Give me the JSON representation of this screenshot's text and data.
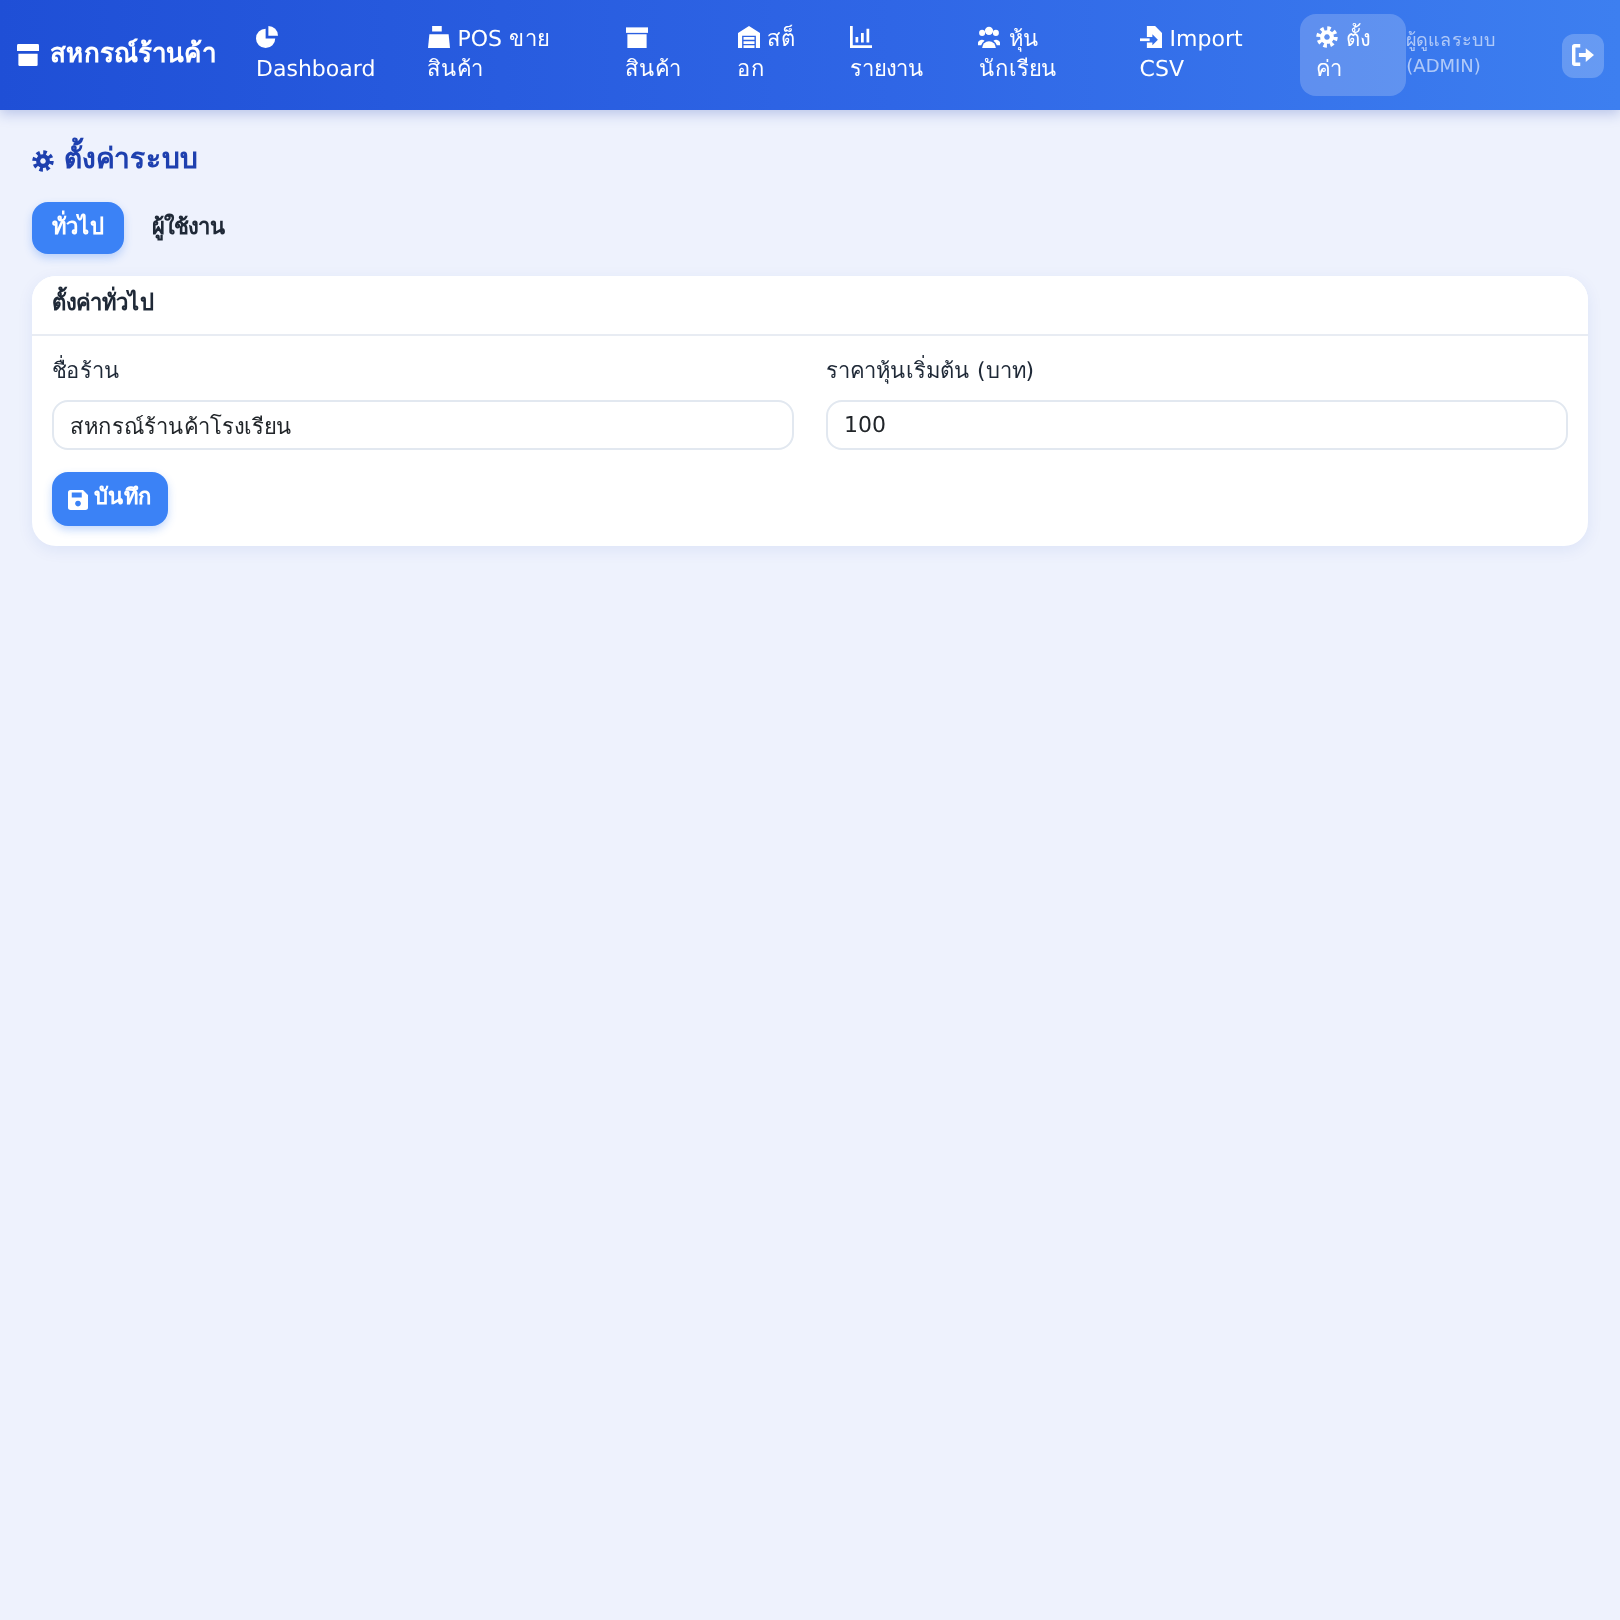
{
  "navbar": {
    "brand": "สหกรณ์ร้านค้า",
    "items": [
      {
        "label": "Dashboard",
        "selected": false
      },
      {
        "label": "POS ขายสินค้า",
        "selected": false
      },
      {
        "label": "สินค้า",
        "selected": false
      },
      {
        "label": "สต็อก",
        "selected": false
      },
      {
        "label": "รายงาน",
        "selected": false
      },
      {
        "label": "หุ้นนักเรียน",
        "selected": false
      },
      {
        "label": "Import CSV",
        "selected": false
      },
      {
        "label": "ตั้งค่า",
        "selected": true
      }
    ],
    "user": "ผู้ดูแลระบบ (ADMIN)"
  },
  "page": {
    "title": "ตั้งค่าระบบ"
  },
  "tabs": [
    {
      "label": "ทั่วไป",
      "selected": true
    },
    {
      "label": "ผู้ใช้งาน",
      "selected": false
    }
  ],
  "card": {
    "title": "ตั้งค่าทั่วไป",
    "fields": [
      {
        "label": "ชื่อร้าน",
        "value": "สหกรณ์ร้านค้าโรงเรียน"
      },
      {
        "label": "ราคาหุ้นเริ่มต้น (บาท)",
        "value": "100"
      }
    ],
    "save_button": "บันทึก"
  }
}
